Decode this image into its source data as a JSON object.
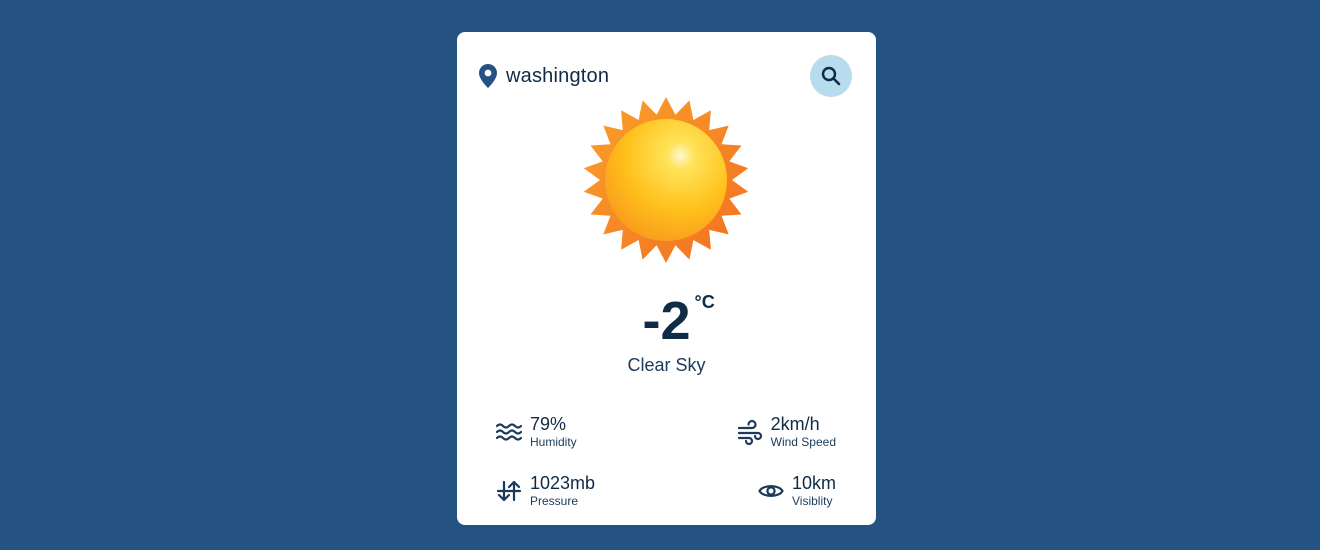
{
  "location": {
    "icon": "map-pin-icon",
    "city": "washington"
  },
  "search": {
    "icon": "search-icon"
  },
  "weather": {
    "icon": "sun-icon",
    "temperature": "-2",
    "unit": "°C",
    "condition": "Clear Sky"
  },
  "stats": {
    "humidity": {
      "icon": "waves-icon",
      "value": "79%",
      "label": "Humidity"
    },
    "wind": {
      "icon": "wind-icon",
      "value": "2km/h",
      "label": "Wind Speed"
    },
    "pressure": {
      "icon": "arrows-up-down-icon",
      "value": "1023mb",
      "label": "Pressure"
    },
    "visibility": {
      "icon": "eye-icon",
      "value": "10km",
      "label": "Visiblity"
    }
  },
  "colors": {
    "background": "#235283",
    "card": "#ffffff",
    "primary_text": "#0f2b45",
    "search_button": "#b7dcee",
    "sun_outer": "#f57d22",
    "sun_inner": "#ffc21c"
  }
}
